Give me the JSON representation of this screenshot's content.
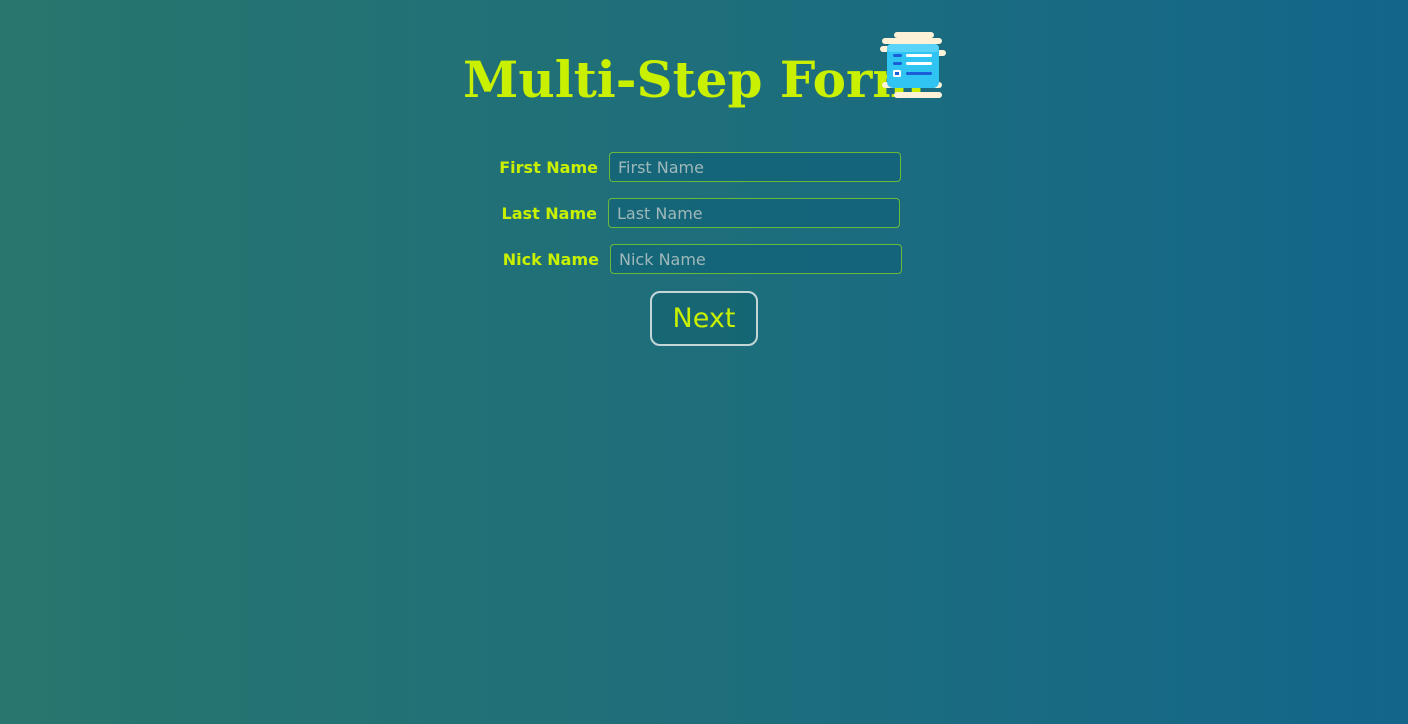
{
  "header": {
    "title": "Multi-Step Form",
    "icon": "form-document-icon"
  },
  "form": {
    "fields": [
      {
        "label": "First Name",
        "placeholder": "First Name",
        "value": ""
      },
      {
        "label": "Last Name",
        "placeholder": "Last Name",
        "value": ""
      },
      {
        "label": "Nick Name",
        "placeholder": "Nick Name",
        "value": ""
      }
    ],
    "next_label": "Next"
  },
  "colors": {
    "accent": "#c8f000",
    "background_left": "#28766d",
    "background_right": "#13668a",
    "input_border": "#6aba3a"
  }
}
